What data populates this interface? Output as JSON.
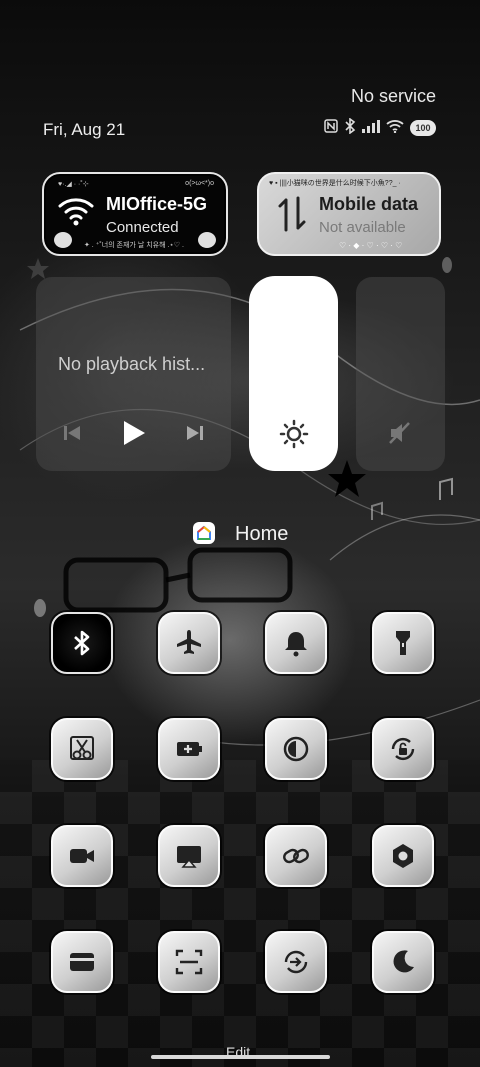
{
  "status": {
    "carrier": "No service",
    "date": "Fri, Aug 21",
    "battery": "100",
    "icons": [
      "nfc-icon",
      "bluetooth-icon",
      "signal-icon",
      "wifi-icon",
      "battery-icon"
    ]
  },
  "wifi_tile": {
    "title": "MIOffice-5G",
    "subtitle": "Connected",
    "deco_top_left": "♥·.◢ · ·˚⊹",
    "deco_top_right": "o(>ω<*)o",
    "deco_bottom": "✦ . ⁺˚너의 존재가 날 치유해 .⋆♡ ."
  },
  "data_tile": {
    "title": "Mobile data",
    "subtitle": "Not available",
    "deco_top": "♥ ▪ ||||小猫咪の世界是什么时候下小魚??_ ·",
    "deco_bottom": "♡ · ◆ · ♡ · ♡ · ♡"
  },
  "media": {
    "title": "No playback hist..."
  },
  "home": {
    "label": "Home"
  },
  "toggles": [
    {
      "name": "bluetooth",
      "active": true
    },
    {
      "name": "airplane-mode",
      "active": false
    },
    {
      "name": "silent-mode",
      "active": false
    },
    {
      "name": "flashlight",
      "active": false
    },
    {
      "name": "screenshot",
      "active": false
    },
    {
      "name": "battery-saver",
      "active": false
    },
    {
      "name": "dark-mode",
      "active": false
    },
    {
      "name": "rotation-lock",
      "active": false
    },
    {
      "name": "screen-recorder",
      "active": false
    },
    {
      "name": "cast",
      "active": false
    },
    {
      "name": "link-share",
      "active": false
    },
    {
      "name": "settings",
      "active": false
    },
    {
      "name": "card-wallet",
      "active": false
    },
    {
      "name": "scanner",
      "active": false
    },
    {
      "name": "sync",
      "active": false
    },
    {
      "name": "night-mode",
      "active": false
    }
  ],
  "footer": {
    "edit_label": "Edit"
  },
  "colors": {
    "tile_light": "#e6e6e6",
    "tile_dark": "#050505",
    "brightness": "#ffffff"
  }
}
